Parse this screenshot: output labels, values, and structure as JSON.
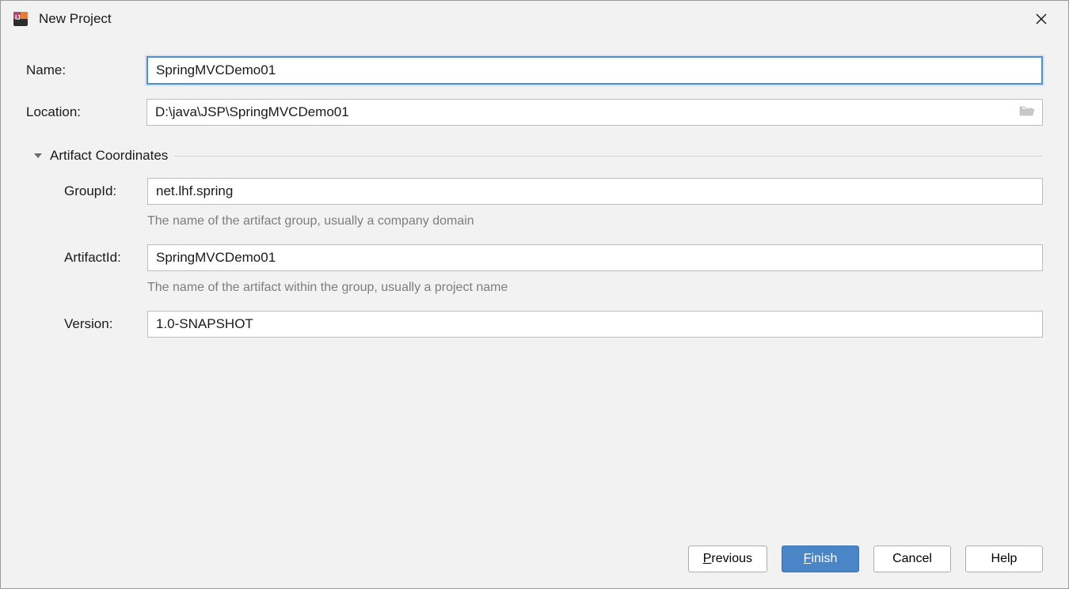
{
  "window": {
    "title": "New Project"
  },
  "form": {
    "name_label": "Name:",
    "name_value": "SpringMVCDemo01",
    "location_label": "Location:",
    "location_value": "D:\\java\\JSP\\SpringMVCDemo01"
  },
  "section": {
    "title": "Artifact Coordinates",
    "groupid_label": "GroupId:",
    "groupid_value": "net.lhf.spring",
    "groupid_hint": "The name of the artifact group, usually a company domain",
    "artifactid_label": "ArtifactId:",
    "artifactid_value": "SpringMVCDemo01",
    "artifactid_hint": "The name of the artifact within the group, usually a project name",
    "version_label": "Version:",
    "version_value": "1.0-SNAPSHOT"
  },
  "buttons": {
    "previous": "revious",
    "previous_mn": "P",
    "finish": "inish",
    "finish_mn": "F",
    "cancel": "Cancel",
    "help": "Help"
  }
}
